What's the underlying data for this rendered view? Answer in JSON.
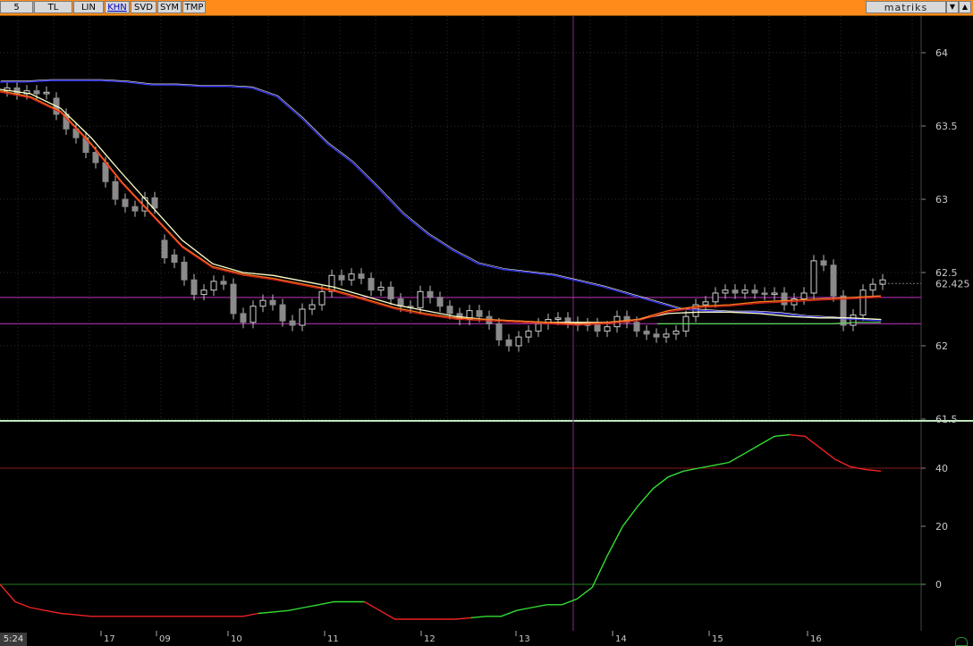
{
  "toolbar": {
    "buttons": [
      {
        "label": "5",
        "active": false
      },
      {
        "label": "TL",
        "active": false
      },
      {
        "label": "LIN",
        "active": false
      },
      {
        "label": "KHN",
        "active": true
      },
      {
        "label": "SVD",
        "active": false
      },
      {
        "label": "SYM",
        "active": false
      },
      {
        "label": "TMP",
        "active": false
      }
    ],
    "logo": "matriks",
    "dropdown_icon": "chevron-down-icon",
    "up_icon": "chevron-up-icon"
  },
  "status": {
    "clock": "5:24"
  },
  "colors": {
    "toolbar_bg": "#ff8c1a",
    "background": "#000000",
    "candle": "#8a8a8a",
    "ma_blue": "#3a3aff",
    "ma_white": "#ffffcc",
    "ma_orange": "#ff7a1a",
    "ma_red": "#e02020",
    "level_line": "#9a2a9a",
    "indicator_up": "#33dd33",
    "indicator_down": "#ee2222"
  },
  "chart_data": [
    {
      "type": "candlestick",
      "title": "",
      "ylim": [
        61.5,
        64.2
      ],
      "yticks": [
        64,
        63.5,
        63,
        62.5,
        62,
        61.5
      ],
      "last_price": 62.425,
      "x_labels": [
        "17",
        "09",
        "10",
        "11",
        "12",
        "13",
        "14",
        "15",
        "16"
      ],
      "horizontal_levels": [
        62.33,
        62.15
      ],
      "vertical_cursor_x": 94,
      "candles_close": [
        63.76,
        63.72,
        63.74,
        63.72,
        63.73,
        63.58,
        63.48,
        63.42,
        63.32,
        63.25,
        63.12,
        63.0,
        62.95,
        62.92,
        63.01,
        62.94,
        62.6,
        62.57,
        62.45,
        62.35,
        62.38,
        62.44,
        62.42,
        62.22,
        62.16,
        62.27,
        62.31,
        62.28,
        62.17,
        62.14,
        62.25,
        62.28,
        62.37,
        62.48,
        62.45,
        62.49,
        62.46,
        62.38,
        62.4,
        62.32,
        62.27,
        62.26,
        62.37,
        62.33,
        62.27,
        62.22,
        62.18,
        62.24,
        62.2,
        62.15,
        62.04,
        62.0,
        62.06,
        62.1,
        62.15,
        62.18,
        62.19,
        62.16,
        62.14,
        62.15,
        62.1,
        62.13,
        62.2,
        62.16,
        62.1,
        62.08,
        62.06,
        62.08,
        62.1,
        62.2,
        62.28,
        62.3,
        62.36,
        62.38,
        62.36,
        62.38,
        62.36,
        62.35,
        62.36,
        62.28,
        62.32,
        62.36,
        62.58,
        62.55,
        62.34,
        62.14,
        62.21,
        62.38,
        62.42,
        62.45
      ],
      "candles_open": [
        63.74,
        63.76,
        63.72,
        63.74,
        63.72,
        63.69,
        63.58,
        63.48,
        63.42,
        63.32,
        63.25,
        63.12,
        63.0,
        62.95,
        62.92,
        63.01,
        62.72,
        62.62,
        62.57,
        62.45,
        62.35,
        62.38,
        62.44,
        62.42,
        62.22,
        62.16,
        62.27,
        62.31,
        62.28,
        62.17,
        62.14,
        62.25,
        62.28,
        62.37,
        62.48,
        62.45,
        62.49,
        62.46,
        62.38,
        62.4,
        62.32,
        62.27,
        62.26,
        62.37,
        62.33,
        62.27,
        62.22,
        62.18,
        62.24,
        62.2,
        62.15,
        62.04,
        62.0,
        62.06,
        62.1,
        62.15,
        62.18,
        62.19,
        62.16,
        62.14,
        62.15,
        62.1,
        62.13,
        62.2,
        62.16,
        62.1,
        62.08,
        62.06,
        62.08,
        62.1,
        62.2,
        62.28,
        62.3,
        62.36,
        62.38,
        62.36,
        62.38,
        62.36,
        62.35,
        62.36,
        62.28,
        62.32,
        62.36,
        62.58,
        62.55,
        62.34,
        62.14,
        62.21,
        62.38,
        62.42
      ],
      "ma_blue": [
        63.8,
        63.8,
        63.81,
        63.81,
        63.81,
        63.8,
        63.78,
        63.78,
        63.77,
        63.77,
        63.76,
        63.7,
        63.55,
        63.38,
        63.25,
        63.08,
        62.9,
        62.76,
        62.65,
        62.56,
        62.52,
        62.5,
        62.48,
        62.44,
        62.4,
        62.35,
        62.3,
        62.25,
        62.24,
        62.23,
        62.23,
        62.22,
        62.2,
        62.19,
        62.18,
        62.17
      ],
      "ma_white": [
        63.75,
        63.72,
        63.62,
        63.42,
        63.18,
        62.95,
        62.72,
        62.56,
        62.5,
        62.48,
        62.44,
        62.4,
        62.34,
        62.28,
        62.24,
        62.2,
        62.18,
        62.17,
        62.16,
        62.16,
        62.16,
        62.18,
        62.22,
        62.23,
        62.23,
        62.22,
        62.2,
        62.19,
        62.19,
        62.18
      ],
      "ma_orange": [
        63.74,
        63.7,
        63.6,
        63.38,
        63.12,
        62.9,
        62.68,
        62.54,
        62.49,
        62.46,
        62.42,
        62.38,
        62.32,
        62.26,
        62.22,
        62.19,
        62.18,
        62.17,
        62.16,
        62.15,
        62.16,
        62.18,
        62.24,
        62.27,
        62.28,
        62.3,
        62.31,
        62.32,
        62.33,
        62.34
      ],
      "ma_green_tail": [
        62.15,
        62.15,
        62.15,
        62.15,
        62.15,
        62.15,
        62.15,
        62.15,
        62.16,
        62.16
      ]
    },
    {
      "type": "line",
      "title": "",
      "ylim": [
        -12,
        53
      ],
      "yticks": [
        40,
        20,
        0
      ],
      "reference_levels": [
        40,
        0
      ],
      "values": [
        0,
        -6,
        -8,
        -9,
        -10,
        -10.5,
        -11,
        -11,
        -11,
        -11,
        -11,
        -11,
        -11,
        -11,
        -11,
        -11,
        -11,
        -10,
        -9.5,
        -9,
        -8,
        -7,
        -6,
        -6,
        -6,
        -9,
        -12,
        -12,
        -12,
        -12,
        -12,
        -11.5,
        -11,
        -11,
        -9,
        -8,
        -7,
        -7,
        -5,
        -1,
        10,
        20,
        27,
        33,
        37,
        39,
        40,
        41,
        42,
        45,
        48,
        51,
        51.5,
        51,
        47,
        43,
        40.5,
        39.5,
        39
      ],
      "rising_from_index": 27,
      "falling_from_index": 52
    }
  ]
}
